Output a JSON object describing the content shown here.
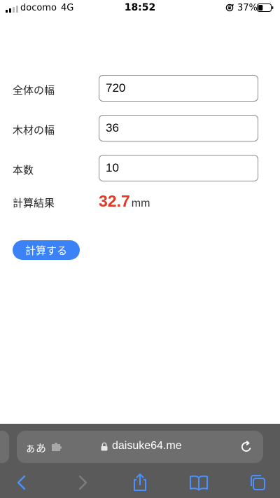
{
  "status_bar": {
    "carrier": "docomo",
    "network": "4G",
    "time": "18:52",
    "battery_percent": "37%",
    "battery_level": 0.37,
    "signal_icon": "signal-bars-icon",
    "rotation_icon": "rotation-lock-icon"
  },
  "form": {
    "total_width": {
      "label": "全体の幅",
      "value": "720"
    },
    "wood_width": {
      "label": "木材の幅",
      "value": "36"
    },
    "count": {
      "label": "本数",
      "value": "10"
    },
    "result": {
      "label": "計算結果",
      "value": "32.7",
      "unit": "mm"
    },
    "calc_button": "計算する"
  },
  "browser": {
    "text_size_label": "ぁあ",
    "url": "daisuke64.me",
    "icons": [
      "puzzle-extension-icon",
      "lock-icon",
      "reload-icon",
      "back-icon",
      "forward-icon",
      "share-icon",
      "bookmarks-icon",
      "tabs-icon"
    ]
  },
  "colors": {
    "accent_blue": "#3b82f6",
    "result_red": "#e03a25",
    "safari_bar": "#5a5a5a",
    "safari_control": "#6e6e6e",
    "toolbar_icon": "#4a90ff"
  }
}
